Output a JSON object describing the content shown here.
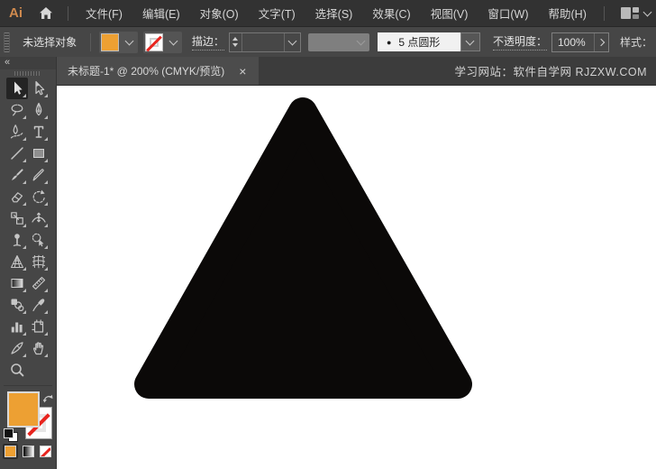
{
  "app": {
    "logo_text": "Ai"
  },
  "menu_bar": {
    "items": [
      {
        "label": "文件(F)"
      },
      {
        "label": "编辑(E)"
      },
      {
        "label": "对象(O)"
      },
      {
        "label": "文字(T)"
      },
      {
        "label": "选择(S)"
      },
      {
        "label": "效果(C)"
      },
      {
        "label": "视图(V)"
      },
      {
        "label": "窗口(W)"
      },
      {
        "label": "帮助(H)"
      }
    ]
  },
  "control_bar": {
    "selection_status": "未选择对象",
    "stroke_label": "描边：",
    "stroke_weight_value": "",
    "brush_bullet": "●",
    "brush_name": "5 点圆形",
    "opacity_label": "不透明度：",
    "opacity_value": "100%",
    "style_label": "样式："
  },
  "document_tabs": {
    "active_tab_title": "未标题-1* @ 200% (CMYK/预览)",
    "close_glyph": "×",
    "right_watermark": "学习网站：软件自学网  RJZXW.COM"
  },
  "toolbar": {
    "collapse_glyph": "«",
    "tools": [
      {
        "name": "selection",
        "selected": true
      },
      {
        "name": "direct-selection",
        "selected": false
      },
      {
        "name": "lasso",
        "selected": false
      },
      {
        "name": "pen",
        "selected": false
      },
      {
        "name": "curvature",
        "selected": false
      },
      {
        "name": "type",
        "selected": false
      },
      {
        "name": "line-segment",
        "selected": false
      },
      {
        "name": "rectangle",
        "selected": false
      },
      {
        "name": "paintbrush",
        "selected": false
      },
      {
        "name": "pencil",
        "selected": false
      },
      {
        "name": "eraser",
        "selected": false
      },
      {
        "name": "rotate",
        "selected": false
      },
      {
        "name": "scale",
        "selected": false
      },
      {
        "name": "width",
        "selected": false
      },
      {
        "name": "puppet-warp",
        "selected": false
      },
      {
        "name": "shape-builder",
        "selected": false
      },
      {
        "name": "perspective-grid",
        "selected": false
      },
      {
        "name": "mesh",
        "selected": false
      },
      {
        "name": "gradient",
        "selected": false
      },
      {
        "name": "measure",
        "selected": false
      },
      {
        "name": "blend",
        "selected": false
      },
      {
        "name": "eyedropper",
        "selected": false
      },
      {
        "name": "column-graph",
        "selected": false
      },
      {
        "name": "artboard",
        "selected": false
      },
      {
        "name": "knife",
        "selected": false
      },
      {
        "name": "hand",
        "selected": false
      },
      {
        "name": "zoom",
        "selected": false
      }
    ]
  },
  "swatches": {
    "fill_color": "#EDA033",
    "stroke_style": "none",
    "bottom_buttons": [
      "color",
      "gradient",
      "none"
    ]
  },
  "canvas": {
    "shape": "rounded-triangle",
    "shape_color": "#0B0908",
    "background": "#FFFFFF"
  },
  "colors": {
    "accent_orange": "#EDA033",
    "none_red": "#E8251F",
    "menu_bar_bg": "#323232",
    "panel_bg": "#464646",
    "tab_bar_bg": "#3C3C3C",
    "tab_active_bg": "#4C4C4C"
  }
}
